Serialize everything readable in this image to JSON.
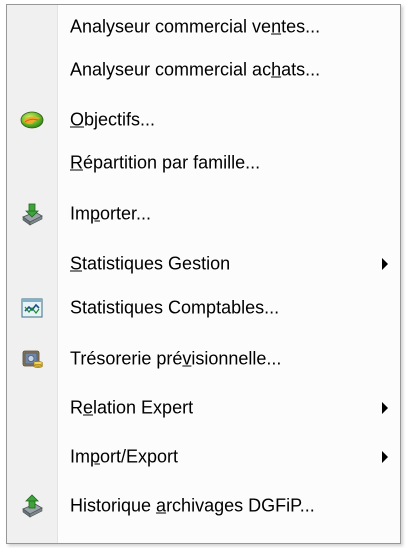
{
  "menu": {
    "items": [
      {
        "id": "analyseur-ventes",
        "pre": "Analyseur commercial ve",
        "ul": "n",
        "post": "tes...",
        "icon": null,
        "submenu": false
      },
      {
        "id": "analyseur-achats",
        "pre": "Analyseur commercial ac",
        "ul": "h",
        "post": "ats...",
        "icon": null,
        "submenu": false
      },
      {
        "id": "objectifs",
        "pre": "",
        "ul": "O",
        "post": "bjectifs...",
        "icon": "objectifs-icon",
        "submenu": false
      },
      {
        "id": "repartition",
        "pre": "",
        "ul": "R",
        "post": "épartition par famille...",
        "icon": null,
        "submenu": false
      },
      {
        "id": "importer",
        "pre": "Im",
        "ul": "p",
        "post": "orter...",
        "icon": "import-icon",
        "submenu": false
      },
      {
        "id": "statistiques-gestion",
        "pre": "",
        "ul": "S",
        "post": "tatistiques Gestion",
        "icon": null,
        "submenu": true
      },
      {
        "id": "statistiques-comptables",
        "pre": "Statistiques Comptables...",
        "ul": "",
        "post": "",
        "icon": "stats-comptables-icon",
        "submenu": false
      },
      {
        "id": "tresorerie",
        "pre": "Trésorerie pré",
        "ul": "v",
        "post": "isionnelle...",
        "icon": "tresorerie-icon",
        "submenu": false
      },
      {
        "id": "relation-expert",
        "pre": "R",
        "ul": "e",
        "post": "lation Expert",
        "icon": null,
        "submenu": true
      },
      {
        "id": "import-export",
        "pre": "Im",
        "ul": "p",
        "post": "ort/Export",
        "icon": null,
        "submenu": true
      },
      {
        "id": "historique-archivages",
        "pre": "Historique ",
        "ul": "a",
        "post": "rchivages DGFiP...",
        "icon": "historique-icon",
        "submenu": false
      }
    ]
  }
}
